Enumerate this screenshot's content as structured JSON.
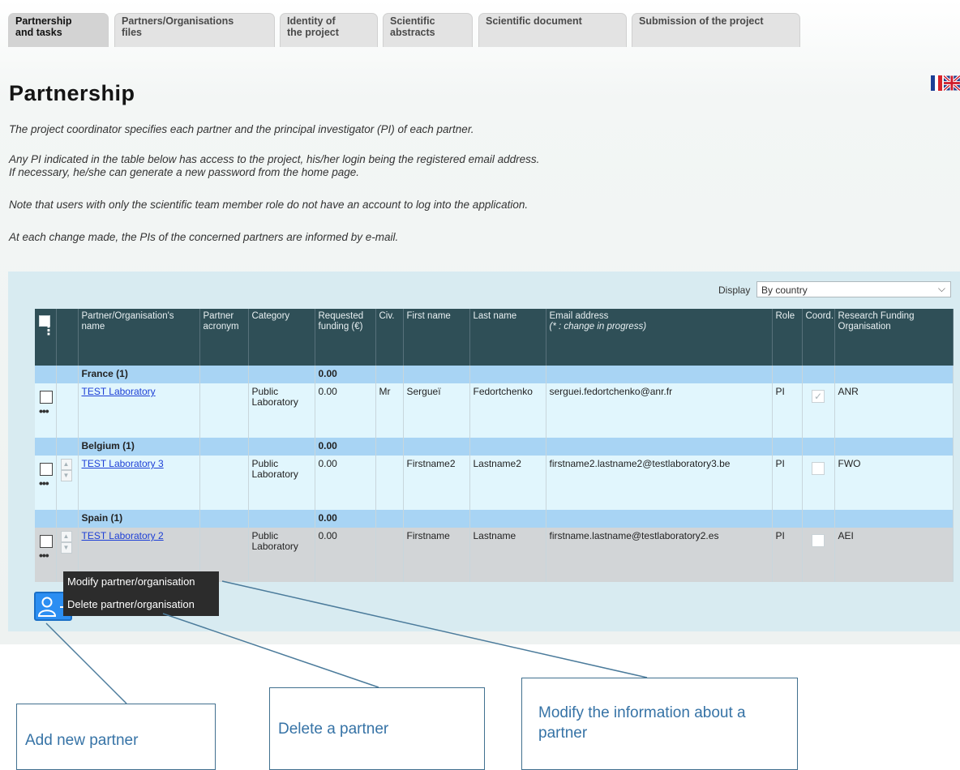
{
  "tabs": [
    {
      "label": "Partnership\nand tasks",
      "active": true
    },
    {
      "label": "Partners/Organisations\nfiles",
      "active": false
    },
    {
      "label": "Identity of\nthe project",
      "active": false
    },
    {
      "label": "Scientific\nabstracts",
      "active": false
    },
    {
      "label": "Scientific document",
      "active": false
    },
    {
      "label": "Submission of the project",
      "active": false
    }
  ],
  "page": {
    "title": "Partnership",
    "intro": [
      "The project coordinator specifies each partner and the principal investigator (PI) of each partner.",
      "Any PI indicated in the table below has access to the project, his/her login being the registered email address.",
      "If necessary, he/she can generate a new password from the home page.",
      "Note that users with only the scientific team member role do not have an account to log into the application.",
      "At each change made, the PIs of the concerned partners are informed by e-mail."
    ]
  },
  "display": {
    "label": "Display",
    "selected": "By country"
  },
  "table": {
    "headers": {
      "name": "Partner/Organisation's name",
      "acronym": "Partner acronym",
      "category": "Category",
      "funding": "Requested funding (€)",
      "civ": "Civ.",
      "first_name": "First name",
      "last_name": "Last name",
      "email": "Email address",
      "email_note": "(* : change in progress)",
      "role": "Role",
      "coord": "Coord.",
      "rfo": "Research Funding Organisation"
    },
    "groups": [
      {
        "label": "France (1)",
        "total": "0.00",
        "rows": [
          {
            "name": "TEST Laboratory",
            "acronym": "",
            "category": "Public Laboratory",
            "funding": "0.00",
            "civ": "Mr",
            "first_name": "Sergueï",
            "last_name": "Fedortchenko",
            "email": "serguei.fedortchenko@anr.fr",
            "role": "PI",
            "coord": "✓",
            "rfo": "ANR"
          }
        ]
      },
      {
        "label": "Belgium (1)",
        "total": "0.00",
        "rows": [
          {
            "name": "TEST Laboratory 3",
            "acronym": "",
            "category": "Public Laboratory",
            "funding": "0.00",
            "civ": "",
            "first_name": "Firstname2",
            "last_name": "Lastname2",
            "email": "firstname2.lastname2@testlaboratory3.be",
            "role": "PI",
            "coord": "",
            "rfo": "FWO"
          }
        ]
      },
      {
        "label": "Spain (1)",
        "total": "0.00",
        "rows": [
          {
            "name": "TEST Laboratory 2",
            "acronym": "",
            "category": "Public Laboratory",
            "funding": "0.00",
            "civ": "",
            "first_name": "Firstname",
            "last_name": "Lastname",
            "email": "firstname.lastname@testlaboratory2.es",
            "role": "PI",
            "coord": "",
            "rfo": "AEI"
          }
        ]
      }
    ],
    "row_menu_dots": "•••",
    "arrow_up": "▲",
    "arrow_down": "▼"
  },
  "context_menu": {
    "modify": "Modify partner/organisation",
    "delete": "Delete partner/organisation"
  },
  "callouts": {
    "add": "Add new partner",
    "delete": "Delete a partner",
    "modify": "Modify the information about a partner"
  },
  "colors": {
    "header_bg": "#2f4f57",
    "group_bg": "#a8d4f4",
    "row_light_bg": "#e1f6fd",
    "row_selected_bg": "#d2d5d7",
    "panel_bg": "#d8ebf1",
    "link": "#1d3fd6",
    "callout_text": "#3673a6",
    "add_button": "#2b8ef2"
  },
  "icons": {
    "flag_fr": "france-flag-icon",
    "flag_uk": "uk-flag-icon",
    "add_user": "add-user-icon"
  }
}
